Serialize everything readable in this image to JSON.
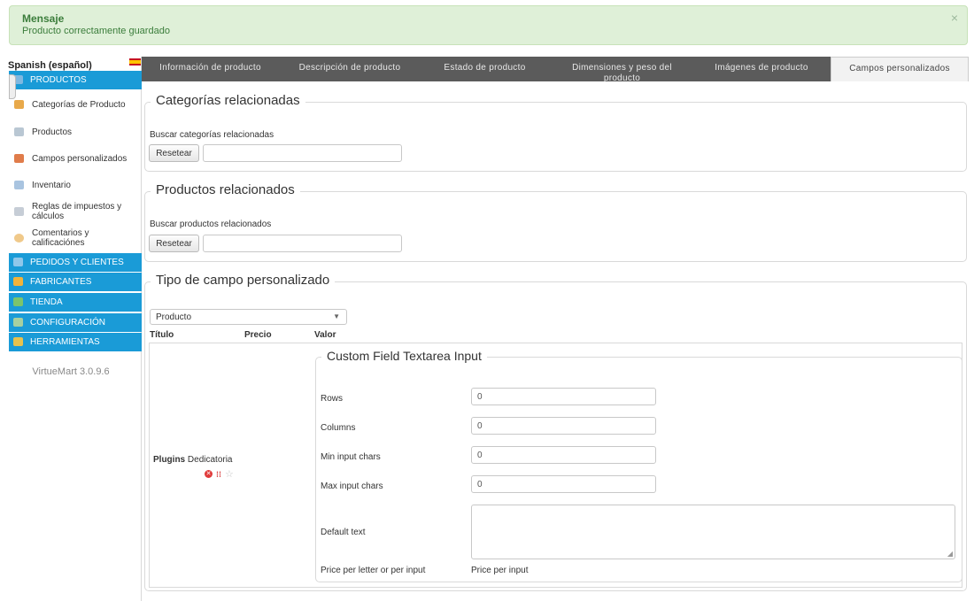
{
  "message": {
    "title": "Mensaje",
    "text": "Producto correctamente guardado",
    "close": "×"
  },
  "sidebar": {
    "language": "Spanish (español)",
    "version": "VirtueMart 3.0.9.6",
    "sections": [
      {
        "label": "PRODUCTOS",
        "color": "#1a9bd7"
      },
      {
        "label": "PEDIDOS Y CLIENTES"
      },
      {
        "label": "FABRICANTES"
      },
      {
        "label": "TIENDA"
      },
      {
        "label": "CONFIGURACIÓN"
      },
      {
        "label": "HERRAMIENTAS"
      }
    ],
    "items": [
      {
        "label": "Categorías de Producto"
      },
      {
        "label": "Productos"
      },
      {
        "label": "Campos personalizados"
      },
      {
        "label": "Inventario"
      },
      {
        "label": "Reglas de impuestos y cálculos"
      },
      {
        "label": "Comentarios y calificaciónes"
      }
    ]
  },
  "tabs": [
    {
      "label": "Información de producto"
    },
    {
      "label": "Descripción de producto"
    },
    {
      "label": "Estado de producto"
    },
    {
      "label": "Dimensiones y peso del producto"
    },
    {
      "label": "Imágenes de producto"
    },
    {
      "label": "Campos personalizados",
      "active": true
    }
  ],
  "related_categories": {
    "legend": "Categorías relacionadas",
    "search_label": "Buscar categorías relacionadas",
    "reset_label": "Resetear",
    "search_value": ""
  },
  "related_products": {
    "legend": "Productos relacionados",
    "search_label": "Buscar productos relacionados",
    "reset_label": "Resetear",
    "search_value": ""
  },
  "custom_field_type": {
    "legend": "Tipo de campo personalizado",
    "select_value": "Producto",
    "columns": [
      "Título",
      "Precio",
      "Valor"
    ],
    "plugin": {
      "title_bold": "Plugins",
      "title": "Dedicatoria"
    },
    "textarea_input": {
      "legend": "Custom Field Textarea Input",
      "rows_label": "Rows",
      "rows_value": "0",
      "columns_label": "Columns",
      "columns_value": "0",
      "min_label": "Min input chars",
      "min_value": "0",
      "max_label": "Max input chars",
      "max_value": "0",
      "default_label": "Default text",
      "default_value": "",
      "price_label": "Price per letter or per input",
      "price_value": "Price per input"
    }
  }
}
